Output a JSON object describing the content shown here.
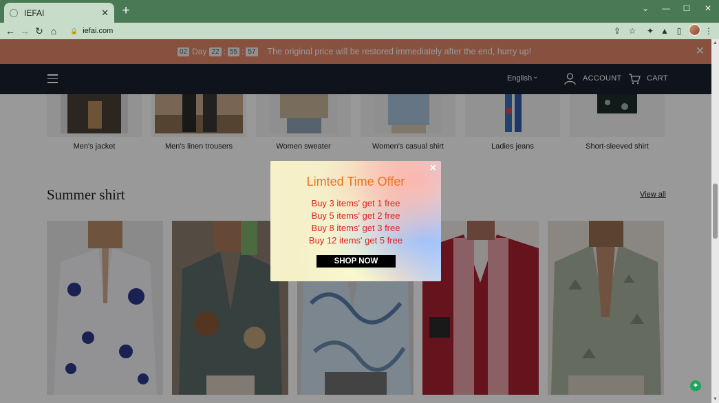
{
  "browser": {
    "tab_title": "IEFAI",
    "new_tab_symbol": "+",
    "url": "iefai.com"
  },
  "announcement": {
    "days": "02",
    "day_label": "Day",
    "hours": "22",
    "minutes": "55",
    "seconds": "57",
    "message": "The original price will be restored immediately after the end, hurry up!"
  },
  "header": {
    "language": "English",
    "account_label": "ACCOUNT",
    "cart_label": "CART"
  },
  "categories": [
    {
      "label": "Men's jacket"
    },
    {
      "label": "Men's linen trousers"
    },
    {
      "label": "Women sweater"
    },
    {
      "label": "Women's casual shirt"
    },
    {
      "label": "Ladies jeans"
    },
    {
      "label": "Short-sleeved shirt"
    }
  ],
  "section": {
    "title": "Summer shirt",
    "view_all": "View all"
  },
  "popup": {
    "close_symbol": "×",
    "title": "Limted Time Offer",
    "offers": [
      "Buy 3 items' get 1 free",
      "Buy 5 items' get 2 free",
      "Buy 8 items' get 3 free",
      "Buy 12 items' get 5 free"
    ],
    "button": "SHOP NOW"
  },
  "colors": {
    "announce_bg": "#e3876a",
    "header_bg": "#1a2030",
    "popup_title": "#e8731c",
    "offer_text": "#e02020"
  }
}
